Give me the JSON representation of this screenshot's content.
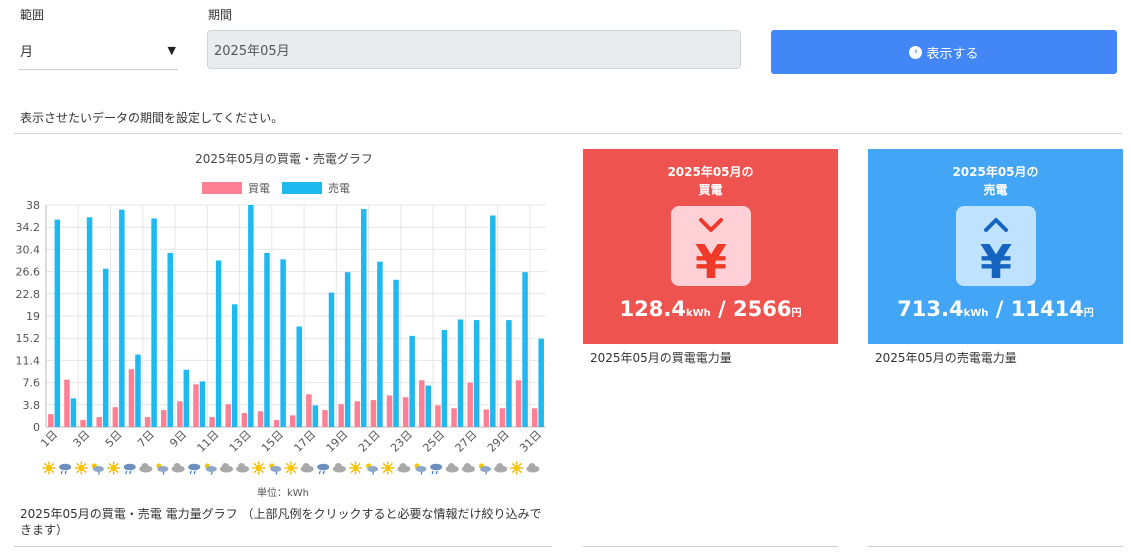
{
  "form": {
    "range_label": "範囲",
    "range_value": "月",
    "period_label": "期間",
    "period_value": "2025年05月",
    "show_button": "表示する",
    "hint": "表示させたいデータの期間を設定してください。"
  },
  "chart_data": {
    "type": "bar",
    "title": "2025年05月の買電・売電グラフ",
    "unit": "単位：kWh",
    "categories": [
      "1日",
      "2日",
      "3日",
      "4日",
      "5日",
      "6日",
      "7日",
      "8日",
      "9日",
      "10日",
      "11日",
      "12日",
      "13日",
      "14日",
      "15日",
      "16日",
      "17日",
      "18日",
      "19日",
      "20日",
      "21日",
      "22日",
      "23日",
      "24日",
      "25日",
      "26日",
      "27日",
      "28日",
      "29日",
      "30日",
      "31日"
    ],
    "series": [
      {
        "name": "買電",
        "color": "#ff8095",
        "values": [
          2.2,
          8.1,
          1.2,
          1.7,
          3.4,
          9.9,
          1.7,
          2.9,
          4.4,
          7.3,
          1.7,
          3.9,
          2.4,
          2.7,
          1.2,
          2.0,
          5.6,
          2.9,
          3.9,
          4.4,
          4.6,
          5.4,
          5.1,
          8.0,
          3.7,
          3.2,
          7.6,
          3.0,
          3.2,
          8.0,
          3.2
        ]
      },
      {
        "name": "売電",
        "color": "#1fb8ef",
        "values": [
          35.5,
          4.9,
          35.9,
          27.1,
          37.2,
          12.4,
          35.7,
          29.8,
          9.8,
          7.8,
          28.5,
          21.0,
          38.0,
          29.8,
          28.7,
          17.2,
          3.7,
          23.0,
          26.5,
          37.3,
          28.3,
          25.2,
          15.6,
          7.1,
          16.6,
          18.4,
          18.3,
          36.2,
          18.3,
          26.5,
          15.1
        ]
      }
    ],
    "y_ticks": [
      "38",
      "34.2",
      "30.4",
      "26.6",
      "22.8",
      "19",
      "15.2",
      "11.4",
      "7.6",
      "3.8",
      "0"
    ],
    "x_tick_labels": [
      "1日",
      "3日",
      "5日",
      "7日",
      "9日",
      "11日",
      "13日",
      "15日",
      "17日",
      "19日",
      "21日",
      "23日",
      "25日",
      "27日",
      "29日",
      "31日"
    ],
    "ylim": [
      0,
      38
    ],
    "grid": true,
    "legend": "top",
    "weather_icons": [
      "sunny",
      "rain",
      "sunny",
      "cloudy-rain",
      "sunny",
      "rain",
      "cloudy",
      "cloudy-rain",
      "cloudy",
      "rain",
      "cloudy-rain",
      "cloudy",
      "cloudy",
      "sunny",
      "cloudy-rain",
      "sunny",
      "cloudy",
      "rain",
      "cloudy",
      "sunny",
      "cloudy-rain",
      "sunny",
      "cloudy",
      "cloudy-rain",
      "rain",
      "cloudy",
      "cloudy",
      "cloudy-rain",
      "cloudy",
      "sunny",
      "cloudy"
    ]
  },
  "chart_caption": "2025年05月の買電・売電 電力量グラフ （上部凡例をクリックすると必要な情報だけ絞り込みできます）",
  "buy_card": {
    "title_line1": "2025年05月の",
    "title_line2": "買電",
    "kwh": "128.4",
    "yen": "2566",
    "kwh_unit": "kWh",
    "yen_unit": "円",
    "separator": " / ",
    "caption": "2025年05月の買電電力量",
    "color": "#ef5350"
  },
  "sell_card": {
    "title_line1": "2025年05月の",
    "title_line2": "売電",
    "kwh": "713.4",
    "yen": "11414",
    "kwh_unit": "kWh",
    "yen_unit": "円",
    "separator": " / ",
    "caption": "2025年05月の売電電力量",
    "color": "#42a5f5"
  }
}
